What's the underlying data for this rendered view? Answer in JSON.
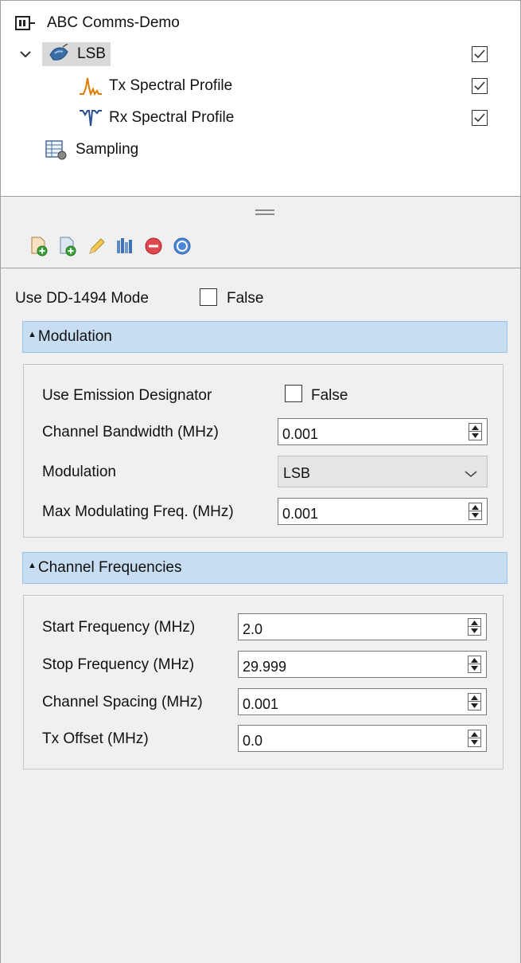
{
  "tree": {
    "root_label": "ABC Comms-Demo",
    "items": [
      {
        "label": "LSB",
        "checked": true,
        "selected": true,
        "expanded": true
      },
      {
        "label": "Tx Spectral Profile",
        "checked": true
      },
      {
        "label": "Rx Spectral Profile",
        "checked": true
      },
      {
        "label": "Sampling"
      }
    ]
  },
  "toolbar": {
    "buttons": [
      "add-icon",
      "add-copy-icon",
      "edit-pencil-icon",
      "bars-icon",
      "delete-icon",
      "help-icon"
    ]
  },
  "form": {
    "dd1494": {
      "label": "Use DD-1494 Mode",
      "value": "False"
    },
    "modulation_section": {
      "title": "Modulation",
      "use_emission": {
        "label": "Use Emission Designator",
        "value": "False"
      },
      "channel_bandwidth": {
        "label": "Channel Bandwidth (MHz)",
        "value": "0.001"
      },
      "modulation": {
        "label": "Modulation",
        "value": "LSB"
      },
      "max_mod_freq": {
        "label": "Max Modulating Freq. (MHz)",
        "value": "0.001"
      }
    },
    "channel_section": {
      "title": "Channel Frequencies",
      "start_freq": {
        "label": "Start Frequency (MHz)",
        "value": "2.0"
      },
      "stop_freq": {
        "label": "Stop Frequency (MHz)",
        "value": "29.999"
      },
      "channel_spacing": {
        "label": "Channel Spacing (MHz)",
        "value": "0.001"
      },
      "tx_offset": {
        "label": "Tx Offset (MHz)",
        "value": "0.0"
      }
    }
  },
  "colors": {
    "section_header_bg": "#c7ddf2",
    "selection_bg": "#d9d9d9",
    "panel_bg": "#f0f0f0"
  }
}
